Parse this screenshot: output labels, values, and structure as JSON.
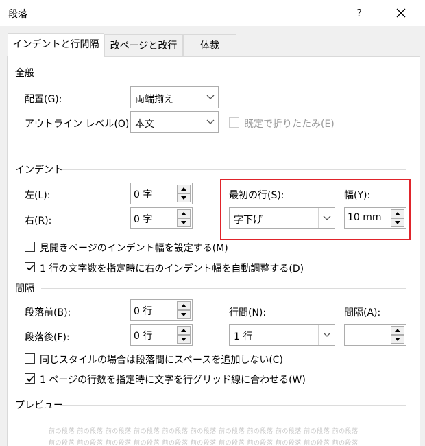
{
  "window": {
    "title": "段落",
    "help_label": "?",
    "close_icon": "close-icon"
  },
  "tabs": [
    {
      "label": "インデントと行間隔",
      "active": true
    },
    {
      "label": "改ページと改行",
      "active": false
    },
    {
      "label": "体裁",
      "active": false
    }
  ],
  "general": {
    "heading": "全般",
    "alignment_label": "配置(G):",
    "alignment_value": "両端揃え",
    "outline_label": "アウトライン レベル(O):",
    "outline_value": "本文",
    "collapsed_label": "既定で折りたたみ(E)",
    "collapsed_checked": false
  },
  "indent": {
    "heading": "インデント",
    "left_label": "左(L):",
    "left_value": "0 字",
    "right_label": "右(R):",
    "right_value": "0 字",
    "first_line_label": "最初の行(S):",
    "first_line_value": "字下げ",
    "width_label": "幅(Y):",
    "width_value": "10 mm",
    "mirror_label": "見開きページのインデント幅を設定する(M)",
    "mirror_checked": false,
    "auto_adjust_label": "1 行の文字数を指定時に右のインデント幅を自動調整する(D)",
    "auto_adjust_checked": true
  },
  "spacing": {
    "heading": "間隔",
    "before_label": "段落前(B):",
    "before_value": "0 行",
    "after_label": "段落後(F):",
    "after_value": "0 行",
    "line_spacing_label": "行間(N):",
    "line_spacing_value": "1 行",
    "at_label": "間隔(A):",
    "at_value": "",
    "no_space_label": "同じスタイルの場合は段落間にスペースを追加しない(C)",
    "no_space_checked": false,
    "grid_label": "1 ページの行数を指定時に文字を行グリッド線に合わせる(W)",
    "grid_checked": true
  },
  "preview": {
    "heading": "プレビュー",
    "sample_line1": "前の段落 前の段落 前の段落 前の段落 前の段落 前の段落 前の段落 前の段落 前の段落 前の段落 前の段落",
    "sample_line2": "前の段落 前の段落 前の段落 前の段落 前の段落 前の段落 前の段落 前の段落 前の段落 前の段落 前の段落"
  },
  "colors": {
    "highlight": "#e0242b",
    "dialog_bg": "#f0f0f0"
  }
}
